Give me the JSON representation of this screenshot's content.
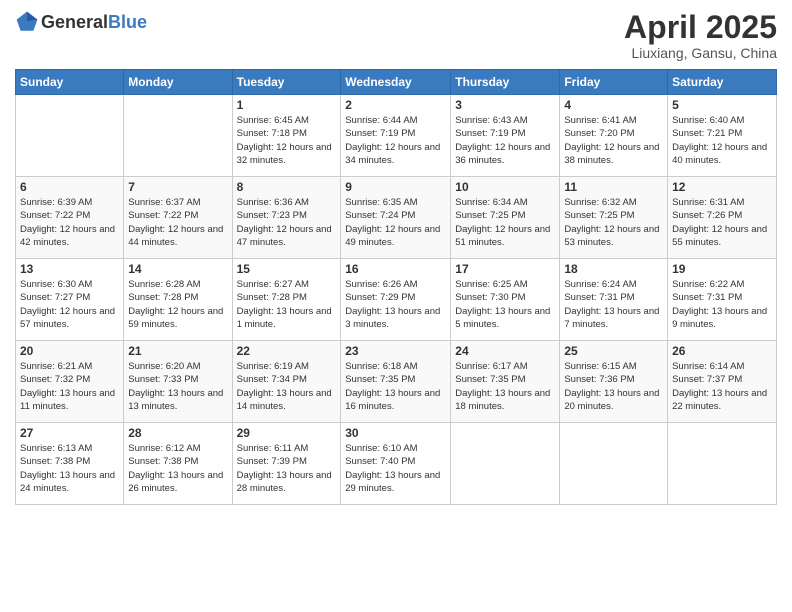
{
  "header": {
    "logo_general": "General",
    "logo_blue": "Blue",
    "month_year": "April 2025",
    "location": "Liuxiang, Gansu, China"
  },
  "days_of_week": [
    "Sunday",
    "Monday",
    "Tuesday",
    "Wednesday",
    "Thursday",
    "Friday",
    "Saturday"
  ],
  "weeks": [
    [
      {
        "day": "",
        "sunrise": "",
        "sunset": "",
        "daylight": ""
      },
      {
        "day": "",
        "sunrise": "",
        "sunset": "",
        "daylight": ""
      },
      {
        "day": "1",
        "sunrise": "Sunrise: 6:45 AM",
        "sunset": "Sunset: 7:18 PM",
        "daylight": "Daylight: 12 hours and 32 minutes."
      },
      {
        "day": "2",
        "sunrise": "Sunrise: 6:44 AM",
        "sunset": "Sunset: 7:19 PM",
        "daylight": "Daylight: 12 hours and 34 minutes."
      },
      {
        "day": "3",
        "sunrise": "Sunrise: 6:43 AM",
        "sunset": "Sunset: 7:19 PM",
        "daylight": "Daylight: 12 hours and 36 minutes."
      },
      {
        "day": "4",
        "sunrise": "Sunrise: 6:41 AM",
        "sunset": "Sunset: 7:20 PM",
        "daylight": "Daylight: 12 hours and 38 minutes."
      },
      {
        "day": "5",
        "sunrise": "Sunrise: 6:40 AM",
        "sunset": "Sunset: 7:21 PM",
        "daylight": "Daylight: 12 hours and 40 minutes."
      }
    ],
    [
      {
        "day": "6",
        "sunrise": "Sunrise: 6:39 AM",
        "sunset": "Sunset: 7:22 PM",
        "daylight": "Daylight: 12 hours and 42 minutes."
      },
      {
        "day": "7",
        "sunrise": "Sunrise: 6:37 AM",
        "sunset": "Sunset: 7:22 PM",
        "daylight": "Daylight: 12 hours and 44 minutes."
      },
      {
        "day": "8",
        "sunrise": "Sunrise: 6:36 AM",
        "sunset": "Sunset: 7:23 PM",
        "daylight": "Daylight: 12 hours and 47 minutes."
      },
      {
        "day": "9",
        "sunrise": "Sunrise: 6:35 AM",
        "sunset": "Sunset: 7:24 PM",
        "daylight": "Daylight: 12 hours and 49 minutes."
      },
      {
        "day": "10",
        "sunrise": "Sunrise: 6:34 AM",
        "sunset": "Sunset: 7:25 PM",
        "daylight": "Daylight: 12 hours and 51 minutes."
      },
      {
        "day": "11",
        "sunrise": "Sunrise: 6:32 AM",
        "sunset": "Sunset: 7:25 PM",
        "daylight": "Daylight: 12 hours and 53 minutes."
      },
      {
        "day": "12",
        "sunrise": "Sunrise: 6:31 AM",
        "sunset": "Sunset: 7:26 PM",
        "daylight": "Daylight: 12 hours and 55 minutes."
      }
    ],
    [
      {
        "day": "13",
        "sunrise": "Sunrise: 6:30 AM",
        "sunset": "Sunset: 7:27 PM",
        "daylight": "Daylight: 12 hours and 57 minutes."
      },
      {
        "day": "14",
        "sunrise": "Sunrise: 6:28 AM",
        "sunset": "Sunset: 7:28 PM",
        "daylight": "Daylight: 12 hours and 59 minutes."
      },
      {
        "day": "15",
        "sunrise": "Sunrise: 6:27 AM",
        "sunset": "Sunset: 7:28 PM",
        "daylight": "Daylight: 13 hours and 1 minute."
      },
      {
        "day": "16",
        "sunrise": "Sunrise: 6:26 AM",
        "sunset": "Sunset: 7:29 PM",
        "daylight": "Daylight: 13 hours and 3 minutes."
      },
      {
        "day": "17",
        "sunrise": "Sunrise: 6:25 AM",
        "sunset": "Sunset: 7:30 PM",
        "daylight": "Daylight: 13 hours and 5 minutes."
      },
      {
        "day": "18",
        "sunrise": "Sunrise: 6:24 AM",
        "sunset": "Sunset: 7:31 PM",
        "daylight": "Daylight: 13 hours and 7 minutes."
      },
      {
        "day": "19",
        "sunrise": "Sunrise: 6:22 AM",
        "sunset": "Sunset: 7:31 PM",
        "daylight": "Daylight: 13 hours and 9 minutes."
      }
    ],
    [
      {
        "day": "20",
        "sunrise": "Sunrise: 6:21 AM",
        "sunset": "Sunset: 7:32 PM",
        "daylight": "Daylight: 13 hours and 11 minutes."
      },
      {
        "day": "21",
        "sunrise": "Sunrise: 6:20 AM",
        "sunset": "Sunset: 7:33 PM",
        "daylight": "Daylight: 13 hours and 13 minutes."
      },
      {
        "day": "22",
        "sunrise": "Sunrise: 6:19 AM",
        "sunset": "Sunset: 7:34 PM",
        "daylight": "Daylight: 13 hours and 14 minutes."
      },
      {
        "day": "23",
        "sunrise": "Sunrise: 6:18 AM",
        "sunset": "Sunset: 7:35 PM",
        "daylight": "Daylight: 13 hours and 16 minutes."
      },
      {
        "day": "24",
        "sunrise": "Sunrise: 6:17 AM",
        "sunset": "Sunset: 7:35 PM",
        "daylight": "Daylight: 13 hours and 18 minutes."
      },
      {
        "day": "25",
        "sunrise": "Sunrise: 6:15 AM",
        "sunset": "Sunset: 7:36 PM",
        "daylight": "Daylight: 13 hours and 20 minutes."
      },
      {
        "day": "26",
        "sunrise": "Sunrise: 6:14 AM",
        "sunset": "Sunset: 7:37 PM",
        "daylight": "Daylight: 13 hours and 22 minutes."
      }
    ],
    [
      {
        "day": "27",
        "sunrise": "Sunrise: 6:13 AM",
        "sunset": "Sunset: 7:38 PM",
        "daylight": "Daylight: 13 hours and 24 minutes."
      },
      {
        "day": "28",
        "sunrise": "Sunrise: 6:12 AM",
        "sunset": "Sunset: 7:38 PM",
        "daylight": "Daylight: 13 hours and 26 minutes."
      },
      {
        "day": "29",
        "sunrise": "Sunrise: 6:11 AM",
        "sunset": "Sunset: 7:39 PM",
        "daylight": "Daylight: 13 hours and 28 minutes."
      },
      {
        "day": "30",
        "sunrise": "Sunrise: 6:10 AM",
        "sunset": "Sunset: 7:40 PM",
        "daylight": "Daylight: 13 hours and 29 minutes."
      },
      {
        "day": "",
        "sunrise": "",
        "sunset": "",
        "daylight": ""
      },
      {
        "day": "",
        "sunrise": "",
        "sunset": "",
        "daylight": ""
      },
      {
        "day": "",
        "sunrise": "",
        "sunset": "",
        "daylight": ""
      }
    ]
  ]
}
